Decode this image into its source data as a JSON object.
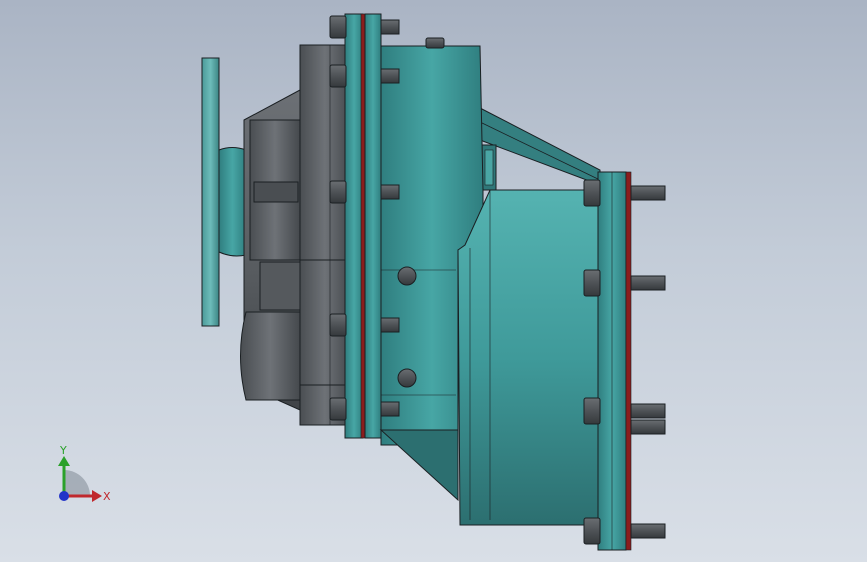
{
  "viewport": {
    "background_top": "#aab4c4",
    "background_bottom": "#d9dfe7"
  },
  "model": {
    "colors": {
      "housing_teal": "#3f9a9a",
      "housing_teal_dark": "#2c6f70",
      "motor_grey": "#5b5f63",
      "motor_grey_dark": "#3c4043",
      "flange_red": "#8a1d1d",
      "bolt": "#4c5054",
      "outline": "#1a1f22"
    },
    "parts": [
      "motor-flange",
      "motor-body",
      "gearbox-upper-housing",
      "gearbox-lower-housing",
      "output-flange",
      "bolts"
    ]
  },
  "triad": {
    "y_label": "Y",
    "x_label": "X",
    "y_color": "#2aa12a",
    "x_color": "#c0282d",
    "z_color": "#2233c8"
  }
}
